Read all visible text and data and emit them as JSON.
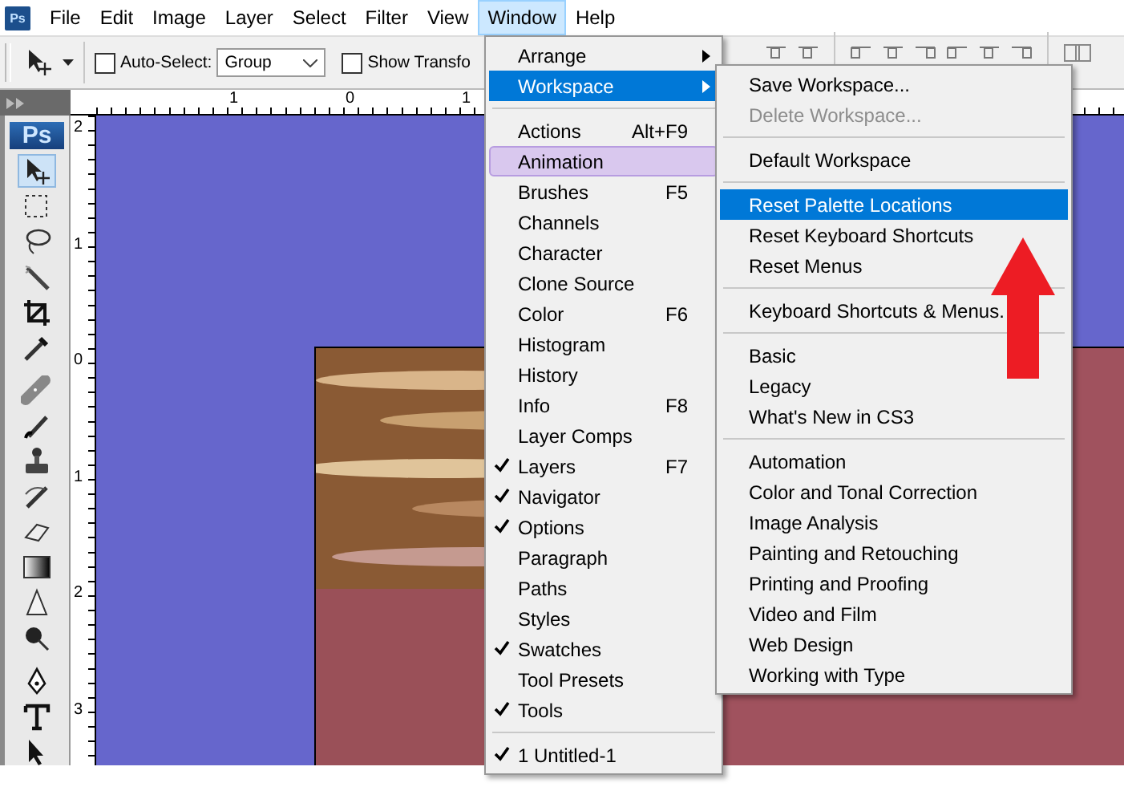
{
  "app_icon": {
    "text": "Ps"
  },
  "menubar": [
    {
      "label": "File",
      "selected": false
    },
    {
      "label": "Edit",
      "selected": false
    },
    {
      "label": "Image",
      "selected": false
    },
    {
      "label": "Layer",
      "selected": false
    },
    {
      "label": "Select",
      "selected": false
    },
    {
      "label": "Filter",
      "selected": false
    },
    {
      "label": "View",
      "selected": false
    },
    {
      "label": "Window",
      "selected": true
    },
    {
      "label": "Help",
      "selected": false
    }
  ],
  "options_bar": {
    "auto_select": {
      "label": "Auto-Select:",
      "checked": false
    },
    "auto_select_target": {
      "value": "Group"
    },
    "show_transform": {
      "label": "Show Transfo",
      "checked": false
    }
  },
  "toolbox": {
    "logo": "Ps"
  },
  "rulers": {
    "horizontal": [
      "1",
      "0",
      "1"
    ],
    "vertical": [
      "2",
      "1",
      "0",
      "1",
      "2",
      "3"
    ]
  },
  "window_menu": {
    "sections": [
      [
        {
          "label": "Arrange",
          "checked": false,
          "submenu": true,
          "selected": false,
          "hovered": false
        },
        {
          "label": "Workspace",
          "checked": false,
          "submenu": true,
          "selected": true,
          "hovered": false
        }
      ],
      [
        {
          "label": "Actions",
          "shortcut": "Alt+F9",
          "checked": false,
          "submenu": false,
          "selected": false,
          "hovered": false
        },
        {
          "label": "Animation",
          "checked": false,
          "submenu": false,
          "selected": false,
          "hovered": true
        },
        {
          "label": "Brushes",
          "shortcut": "F5",
          "checked": false,
          "submenu": false,
          "selected": false,
          "hovered": false
        },
        {
          "label": "Channels",
          "checked": false,
          "submenu": false,
          "selected": false,
          "hovered": false
        },
        {
          "label": "Character",
          "checked": false,
          "submenu": false,
          "selected": false,
          "hovered": false
        },
        {
          "label": "Clone Source",
          "checked": false,
          "submenu": false,
          "selected": false,
          "hovered": false
        },
        {
          "label": "Color",
          "shortcut": "F6",
          "checked": false,
          "submenu": false,
          "selected": false,
          "hovered": false
        },
        {
          "label": "Histogram",
          "checked": false,
          "submenu": false,
          "selected": false,
          "hovered": false
        },
        {
          "label": "History",
          "checked": false,
          "submenu": false,
          "selected": false,
          "hovered": false
        },
        {
          "label": "Info",
          "shortcut": "F8",
          "checked": false,
          "submenu": false,
          "selected": false,
          "hovered": false
        },
        {
          "label": "Layer Comps",
          "checked": false,
          "submenu": false,
          "selected": false,
          "hovered": false
        },
        {
          "label": "Layers",
          "shortcut": "F7",
          "checked": true,
          "submenu": false,
          "selected": false,
          "hovered": false
        },
        {
          "label": "Navigator",
          "checked": true,
          "submenu": false,
          "selected": false,
          "hovered": false
        },
        {
          "label": "Options",
          "checked": true,
          "submenu": false,
          "selected": false,
          "hovered": false
        },
        {
          "label": "Paragraph",
          "checked": false,
          "submenu": false,
          "selected": false,
          "hovered": false
        },
        {
          "label": "Paths",
          "checked": false,
          "submenu": false,
          "selected": false,
          "hovered": false
        },
        {
          "label": "Styles",
          "checked": false,
          "submenu": false,
          "selected": false,
          "hovered": false
        },
        {
          "label": "Swatches",
          "checked": true,
          "submenu": false,
          "selected": false,
          "hovered": false
        },
        {
          "label": "Tool Presets",
          "checked": false,
          "submenu": false,
          "selected": false,
          "hovered": false
        },
        {
          "label": "Tools",
          "checked": true,
          "submenu": false,
          "selected": false,
          "hovered": false
        }
      ],
      [
        {
          "label": "1 Untitled-1",
          "checked": true,
          "submenu": false,
          "selected": false,
          "hovered": false
        }
      ]
    ]
  },
  "workspace_submenu": {
    "sections": [
      [
        {
          "label": "Save Workspace...",
          "disabled": false,
          "selected": false
        },
        {
          "label": "Delete Workspace...",
          "disabled": true,
          "selected": false
        }
      ],
      [
        {
          "label": "Default Workspace",
          "disabled": false,
          "selected": false
        }
      ],
      [
        {
          "label": "Reset Palette Locations",
          "disabled": false,
          "selected": true
        },
        {
          "label": "Reset Keyboard Shortcuts",
          "disabled": false,
          "selected": false
        },
        {
          "label": "Reset Menus",
          "disabled": false,
          "selected": false
        }
      ],
      [
        {
          "label": "Keyboard Shortcuts & Menus.",
          "disabled": false,
          "selected": false
        }
      ],
      [
        {
          "label": "Basic",
          "disabled": false,
          "selected": false
        },
        {
          "label": "Legacy",
          "disabled": false,
          "selected": false
        },
        {
          "label": "What's New in CS3",
          "disabled": false,
          "selected": false
        }
      ],
      [
        {
          "label": "Automation",
          "disabled": false,
          "selected": false
        },
        {
          "label": "Color and Tonal Correction",
          "disabled": false,
          "selected": false
        },
        {
          "label": "Image Analysis",
          "disabled": false,
          "selected": false
        },
        {
          "label": "Painting and Retouching",
          "disabled": false,
          "selected": false
        },
        {
          "label": "Printing and Proofing",
          "disabled": false,
          "selected": false
        },
        {
          "label": "Video and Film",
          "disabled": false,
          "selected": false
        },
        {
          "label": "Web Design",
          "disabled": false,
          "selected": false
        },
        {
          "label": "Working with Type",
          "disabled": false,
          "selected": false
        }
      ]
    ]
  }
}
